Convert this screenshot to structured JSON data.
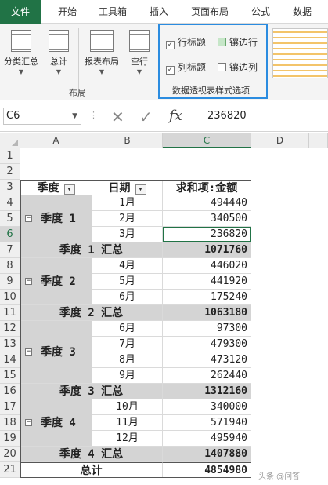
{
  "ribbon_tabs": [
    "文件",
    "开始",
    "工具箱",
    "插入",
    "页面布局",
    "公式",
    "数据"
  ],
  "ribbon": {
    "buttons": [
      {
        "label": "分类汇总"
      },
      {
        "label": "总计"
      },
      {
        "label": "报表布局"
      },
      {
        "label": "空行"
      }
    ],
    "layout_group_label": "布局",
    "style_options_label": "数据透视表样式选项",
    "options": {
      "row_headers": {
        "label": "行标题",
        "checked": true
      },
      "banded_rows": {
        "label": "镶边行",
        "checked": false
      },
      "col_headers": {
        "label": "列标题",
        "checked": true
      },
      "banded_cols": {
        "label": "镶边列",
        "checked": false
      }
    },
    "accent_color": "#2b8ce0"
  },
  "formula_bar": {
    "name_box": "C6",
    "fx_label": "fx",
    "value": "236820"
  },
  "columns": [
    "A",
    "B",
    "C",
    "D"
  ],
  "selected_column": "C",
  "rows": [
    "1",
    "2",
    "3",
    "4",
    "5",
    "6",
    "7",
    "8",
    "9",
    "10",
    "11",
    "12",
    "13",
    "14",
    "15",
    "16",
    "17",
    "18",
    "19",
    "20",
    "21"
  ],
  "selected_row": "6",
  "pivot": {
    "header": {
      "quarter": "季度",
      "date": "日期",
      "sum": "求和项:金额"
    },
    "groups": [
      {
        "label": "季度 1",
        "subtotal_label": "季度 1 汇总",
        "subtotal": "1071760",
        "items": [
          {
            "month": "1月",
            "value": "494440"
          },
          {
            "month": "2月",
            "value": "340500"
          },
          {
            "month": "3月",
            "value": "236820"
          }
        ]
      },
      {
        "label": "季度 2",
        "subtotal_label": "季度 2 汇总",
        "subtotal": "1063180",
        "items": [
          {
            "month": "4月",
            "value": "446020"
          },
          {
            "month": "5月",
            "value": "441920"
          },
          {
            "month": "6月",
            "value": "175240"
          }
        ]
      },
      {
        "label": "季度 3",
        "subtotal_label": "季度 3 汇总",
        "subtotal": "1312160",
        "items": [
          {
            "month": "6月",
            "value": "97300"
          },
          {
            "month": "7月",
            "value": "479300"
          },
          {
            "month": "8月",
            "value": "473120"
          },
          {
            "month": "9月",
            "value": "262440"
          }
        ]
      },
      {
        "label": "季度 4",
        "subtotal_label": "季度 4 汇总",
        "subtotal": "1407880",
        "items": [
          {
            "month": "10月",
            "value": "340000"
          },
          {
            "month": "11月",
            "value": "571940"
          },
          {
            "month": "12月",
            "value": "495940"
          }
        ]
      }
    ],
    "total_label": "总计",
    "total": "4854980"
  },
  "watermark": "头条 @问答"
}
